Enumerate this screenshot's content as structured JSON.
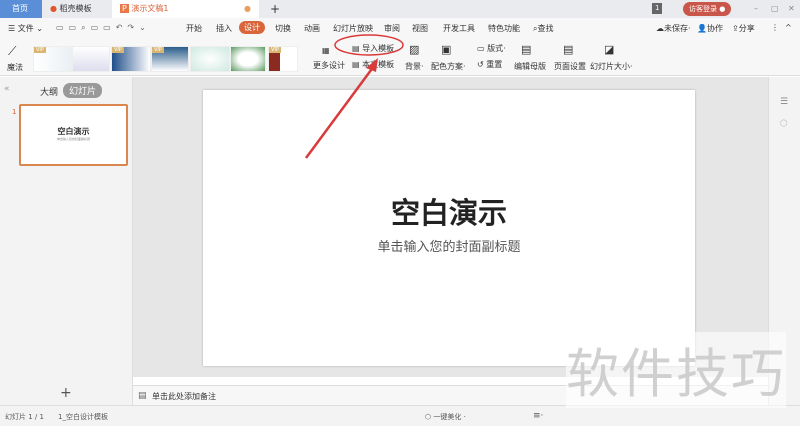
{
  "tabs": [
    {
      "label": "首页"
    },
    {
      "label": "稻壳模板"
    },
    {
      "label": "演示文稿1"
    }
  ],
  "new_tab": "+",
  "window": {
    "page_badge": "1",
    "login": "访客登录",
    "minimize": "–",
    "restore": "▢",
    "close": "✕"
  },
  "menu": {
    "file": "文件",
    "items": [
      "开始",
      "插入",
      "设计",
      "切换",
      "动画",
      "幻灯片放映",
      "审阅",
      "视图",
      "开发工具",
      "特色功能"
    ],
    "active": "设计",
    "search": "查找",
    "unsaved": "未保存",
    "collab": "协作",
    "share": "分享"
  },
  "ribbon": {
    "magic": "魔法",
    "vip": "VIP",
    "more_design": "更多设计",
    "import_template": "导入模板",
    "body_template": "本文模板",
    "background": "背景",
    "color_scheme": "配色方案",
    "layout": "版式",
    "reset": "重置",
    "edit_master": "编辑母版",
    "page_setup": "页面设置",
    "slide_size": "幻灯片大小"
  },
  "left": {
    "outline": "大纲",
    "slides": "幻灯片",
    "slide_num": "1",
    "thumb_title": "空白演示",
    "thumb_sub": "单击输入您的封面副标题",
    "add": "+"
  },
  "slide": {
    "title": "空白演示",
    "subtitle": "单击输入您的封面副标题"
  },
  "notes": {
    "placeholder": "单击此处添加备注"
  },
  "status": {
    "slide_count": "幻灯片 1 / 1",
    "theme": "1_空白设计模板",
    "beautify": "一键美化"
  },
  "watermark": "软件技巧",
  "colors": {
    "accent": "#d9653b",
    "home_tab": "#5a8fd8",
    "annotation": "#d93a3a"
  }
}
